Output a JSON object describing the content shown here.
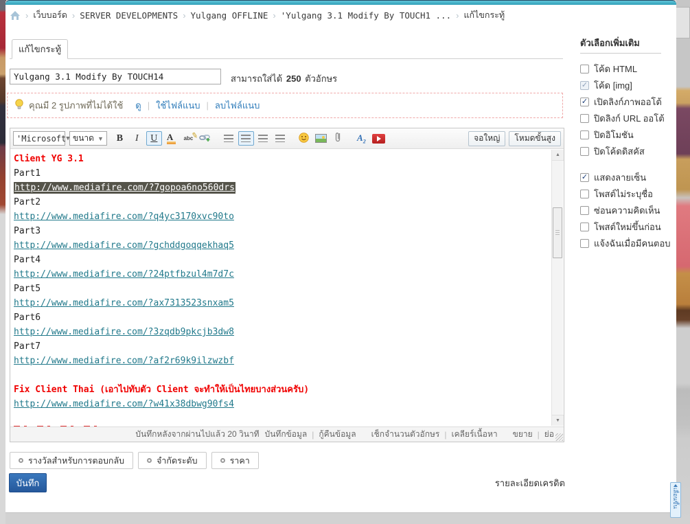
{
  "breadcrumb": {
    "separator": "›",
    "items": [
      "เว็บบอร์ด",
      "SERVER DEVELOPMENTS",
      "Yulgang OFFLINE",
      "'Yulgang 3.1 Modify By TOUCH1 ...",
      "แก้ไขกระทู้"
    ]
  },
  "tab": {
    "label": "แก้ไขกระทู้"
  },
  "title_field": {
    "value": "Yulgang 3.1 Modify By TOUCH14",
    "hint_prefix": "สามารถใส่ได้",
    "hint_count": "250",
    "hint_suffix": "ตัวอักษร"
  },
  "attachment_notice": {
    "message": "คุณมี 2 รูปภาพที่ไม่ได้ใช้",
    "links": [
      "ดู",
      "ใช้ไฟล์แนบ",
      "ลบไฟล์แนบ"
    ]
  },
  "editor": {
    "toolbar": {
      "font_select": "'Microsoft",
      "size_select": "ขนาด",
      "bold_glyph": "B",
      "italic_glyph": "I",
      "underline_glyph": "U",
      "color_glyph": "A",
      "abc_glyph": "abc",
      "a2_glyph": "A",
      "a2_sub": "2",
      "right_buttons": [
        "จอใหญ่",
        "โหมดขั้นสูง"
      ]
    },
    "content_lines": [
      {
        "type": "red",
        "text": "Client YG 3.1"
      },
      {
        "type": "plain",
        "text": "Part1"
      },
      {
        "type": "selected",
        "text": "http://www.mediafire.com/?7gopoa6no560drs"
      },
      {
        "type": "plain",
        "text": "Part2"
      },
      {
        "type": "link",
        "text": "http://www.mediafire.com/?q4yc3170xvc90to"
      },
      {
        "type": "plain",
        "text": "Part3"
      },
      {
        "type": "link",
        "text": "http://www.mediafire.com/?gchddgoqqekhaq5"
      },
      {
        "type": "plain",
        "text": "Part4"
      },
      {
        "type": "link",
        "text": "http://www.mediafire.com/?24ptfbzul4m7d7c"
      },
      {
        "type": "plain",
        "text": "Part5"
      },
      {
        "type": "link",
        "text": "http://www.mediafire.com/?ax7313523snxam5"
      },
      {
        "type": "plain",
        "text": "Part6"
      },
      {
        "type": "link",
        "text": "http://www.mediafire.com/?3zqdb9pkcjb3dw8"
      },
      {
        "type": "plain",
        "text": "Part7"
      },
      {
        "type": "link",
        "text": "http://www.mediafire.com/?af2r69k9ilzwzbf"
      },
      {
        "type": "blank",
        "text": ""
      },
      {
        "type": "red",
        "text": "Fix Client Thai (เอาไปทับตัว Client จะทำให้เป็นไทยบางส่วนครับ)"
      },
      {
        "type": "link",
        "text": "http://www.mediafire.com/?w41x38dbwg90fs4"
      },
      {
        "type": "blank",
        "text": ""
      },
      {
        "type": "clipped",
        "text": ""
      }
    ],
    "statusbar": {
      "autosave": "บันทึกหลังจากผ่านไปแล้ว 20 วินาที",
      "groups": [
        [
          "บันทึกข้อมูล",
          "กู้คืนข้อมูล"
        ],
        [
          "เช็กจำนวนตัวอักษร",
          "เคลียร์เนื้อหา"
        ],
        [
          "ขยาย",
          "ย่อ"
        ]
      ]
    }
  },
  "footer": {
    "option_buttons": [
      "รางวัลสำหรับการตอบกลับ",
      "จำกัดระดับ",
      "ราคา"
    ],
    "save_label": "บันทึก",
    "credit_label": "รายละเอียดเครดิต"
  },
  "options_sidebar": {
    "title": "ตัวเลือกเพิ่มเติม",
    "groups": [
      {
        "items": [
          {
            "label": "โค้ด HTML",
            "checked": false,
            "disabled": false
          },
          {
            "label": "โค้ด [img]",
            "checked": true,
            "disabled": true
          },
          {
            "label": "เปิดลิงก์ภาพออโต้",
            "checked": true,
            "disabled": false
          },
          {
            "label": "ปิดลิงก์ URL ออโต้",
            "checked": false,
            "disabled": false
          },
          {
            "label": "ปิดอิโมชัน",
            "checked": false,
            "disabled": false
          },
          {
            "label": "ปิดโค้ดดิสคัส",
            "checked": false,
            "disabled": false
          }
        ]
      },
      {
        "items": [
          {
            "label": "แสดงลายเซ็น",
            "checked": true,
            "disabled": false
          },
          {
            "label": "โพสต์ไม่ระบุชื่อ",
            "checked": false,
            "disabled": false
          },
          {
            "label": "ซ่อนความคิดเห็น",
            "checked": false,
            "disabled": false
          },
          {
            "label": "โพสต์ใหม่ขึ้นก่อน",
            "checked": false,
            "disabled": false
          },
          {
            "label": "แจ้งฉันเมื่อมีคนตอบ",
            "checked": false,
            "disabled": false
          }
        ]
      }
    ]
  },
  "float_tab": {
    "label": "เลื่อนขึ้น"
  },
  "colors": {
    "accent_teal": "#2f9fb8",
    "link": "#21798b",
    "red_text": "#f00000",
    "save_blue": "#25589b"
  }
}
